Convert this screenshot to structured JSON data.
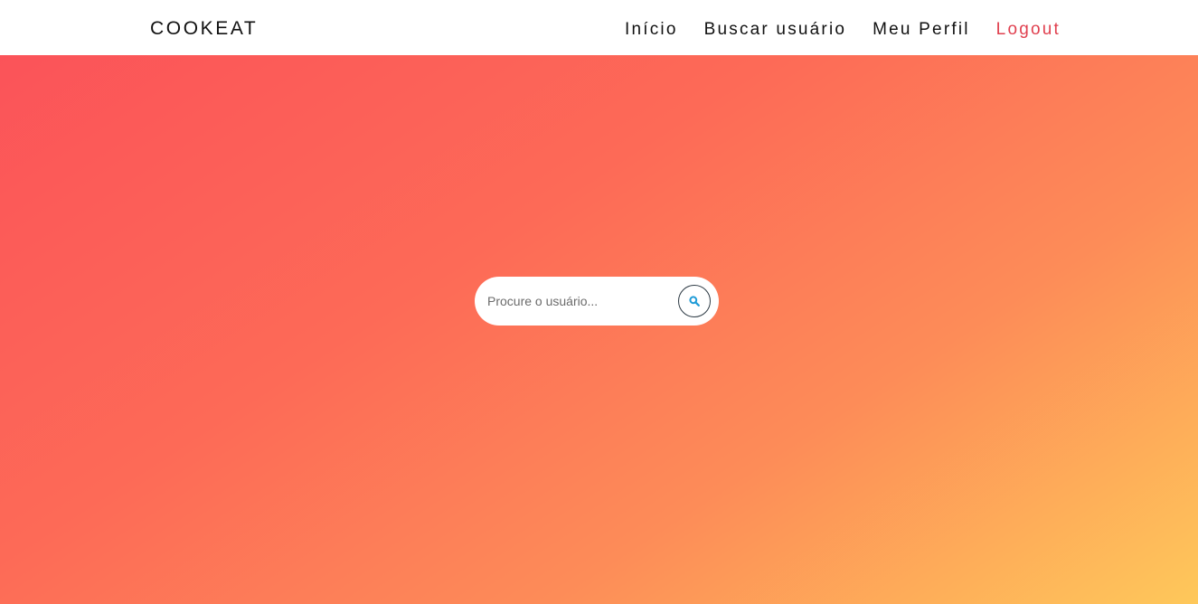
{
  "header": {
    "brand": "COOKEAT",
    "nav": [
      {
        "label": "Início"
      },
      {
        "label": "Buscar usuário"
      },
      {
        "label": "Meu Perfil"
      },
      {
        "label": "Logout"
      }
    ]
  },
  "search": {
    "placeholder": "Procure o usuário...",
    "value": "",
    "button_icon": "search-icon"
  },
  "colors": {
    "logout": "#e0404f",
    "gradient": [
      "#fb5359",
      "#fd6a57",
      "#fd8c58",
      "#fec85a"
    ],
    "search_icon": "#1e9bd7"
  }
}
